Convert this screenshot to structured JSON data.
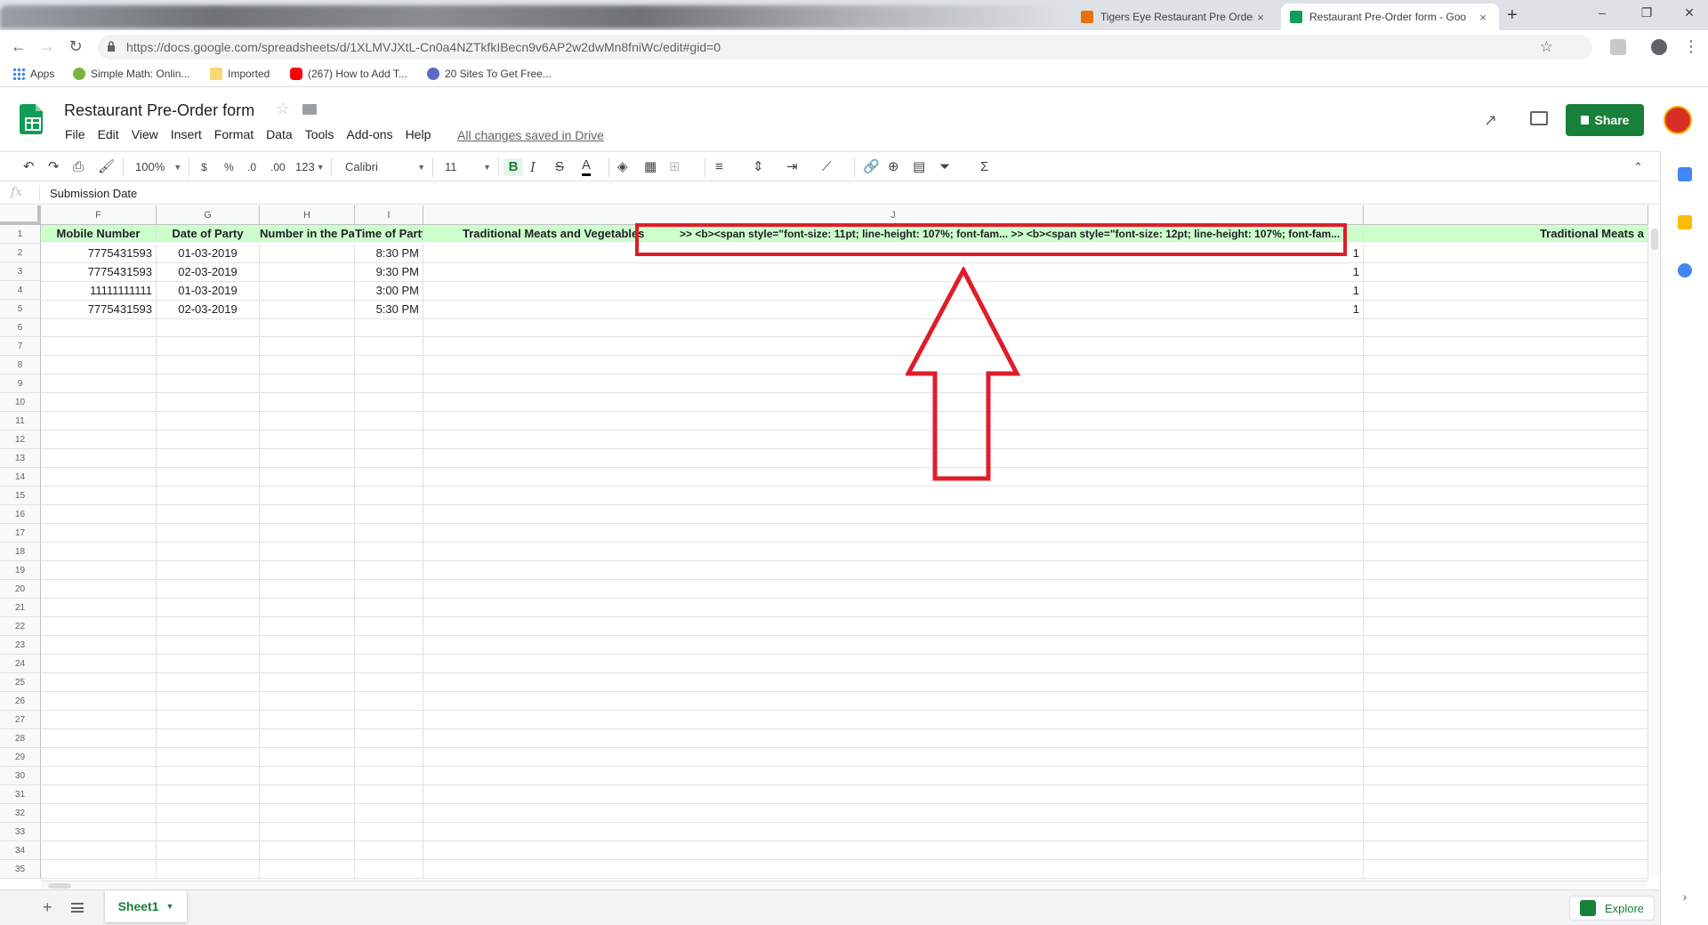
{
  "browser": {
    "tabs": [
      {
        "title": "",
        "blurred": true
      },
      {
        "title": "Tigers Eye Restaurant Pre Order F",
        "close": "×"
      },
      {
        "title": "Restaurant Pre-Order form - Goo",
        "close": "×"
      }
    ],
    "new_tab": "+",
    "window_controls": [
      "–",
      "❐",
      "✕"
    ],
    "url": "https://docs.google.com/spreadsheets/d/1XLMVJXtL-Cn0a4NZTkfkIBecn9v6AP2w2dwMn8fniWc/edit#gid=0",
    "bookmarks": [
      "Apps",
      "Simple Math: Onlin...",
      "Imported",
      "(267) How to Add T...",
      "20 Sites To Get Free..."
    ]
  },
  "doc": {
    "title": "Restaurant Pre-Order form",
    "menu": [
      "File",
      "Edit",
      "View",
      "Insert",
      "Format",
      "Data",
      "Tools",
      "Add-ons",
      "Help"
    ],
    "save_status": "All changes saved in Drive",
    "share_label": "Share"
  },
  "toolbar": {
    "zoom": "100%",
    "currency": "$",
    "percent": "%",
    "dec_decrease": ".0",
    "dec_increase": ".00",
    "more_formats": "123",
    "font": "Calibri",
    "font_size": "11",
    "bold": "B",
    "italic": "I",
    "strike": "S",
    "text_color": "A"
  },
  "formula_bar": {
    "fx": "fx",
    "value": "Submission Date"
  },
  "grid": {
    "columns": [
      "F",
      "G",
      "H",
      "I",
      "J"
    ],
    "header_row": {
      "F": "Mobile Number",
      "G": "Date of Party",
      "H": "Number in the Party",
      "I": "Time of Party",
      "J": "Traditional Meats and Vegetables",
      "J_overflow": ">> <b><span style=\"font-size: 11pt; line-height: 107%; font-fam... >> <b><span style=\"font-size: 12pt; line-height: 107%; font-fam...",
      "K": "Traditional Meats a"
    },
    "rows": [
      {
        "n": "2",
        "mobile": "7775431593",
        "date": "01-03-2019",
        "time": "8:30 PM",
        "qty": "1"
      },
      {
        "n": "3",
        "mobile": "7775431593",
        "date": "02-03-2019",
        "time": "9:30 PM",
        "qty": "1"
      },
      {
        "n": "4",
        "mobile": "11111111111",
        "date": "01-03-2019",
        "time": "3:00 PM",
        "qty": "1"
      },
      {
        "n": "5",
        "mobile": "7775431593",
        "date": "02-03-2019",
        "time": "5:30 PM",
        "qty": "1"
      }
    ],
    "row_numbers": [
      "1",
      "2",
      "3",
      "4",
      "5",
      "6",
      "7",
      "8",
      "9",
      "10",
      "11",
      "12",
      "13",
      "14",
      "15",
      "16",
      "17",
      "18",
      "19",
      "20",
      "21",
      "22",
      "23",
      "24",
      "25",
      "26",
      "27",
      "28",
      "29",
      "30",
      "31",
      "32",
      "33",
      "34",
      "35"
    ]
  },
  "sheet_tabs": {
    "add": "+",
    "active": "Sheet1",
    "explore": "Explore"
  },
  "colors": {
    "header_fill": "#ccffcc",
    "accent_green": "#188038",
    "annotation_red": "#e01c2b"
  }
}
